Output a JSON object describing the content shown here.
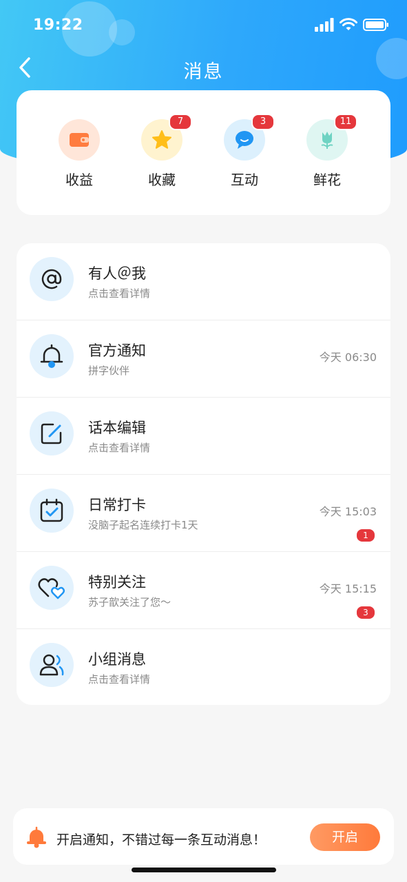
{
  "status_bar": {
    "time": "19:22"
  },
  "nav": {
    "title": "消息"
  },
  "shortcuts": [
    {
      "label": "收益",
      "icon": "wallet-icon",
      "badge": ""
    },
    {
      "label": "收藏",
      "icon": "star-icon",
      "badge": "7"
    },
    {
      "label": "互动",
      "icon": "chat-bubble-icon",
      "badge": "3"
    },
    {
      "label": "鲜花",
      "icon": "flower-icon",
      "badge": "11"
    }
  ],
  "messages": [
    {
      "title": "有人＠我",
      "subtitle": "点击查看详情",
      "time": "",
      "badge": "",
      "icon": "at-icon"
    },
    {
      "title": "官方通知",
      "subtitle": "拼字伙伴",
      "time": "今天 06:30",
      "badge": "",
      "icon": "bell-icon"
    },
    {
      "title": "话本编辑",
      "subtitle": "点击查看详情",
      "time": "",
      "badge": "",
      "icon": "edit-icon"
    },
    {
      "title": "日常打卡",
      "subtitle": "没脑子起名连续打卡1天",
      "time": "今天 15:03",
      "badge": "1",
      "icon": "calendar-check-icon"
    },
    {
      "title": "特别关注",
      "subtitle": "苏子歆关注了您～",
      "time": "今天 15:15",
      "badge": "3",
      "icon": "hearts-icon"
    },
    {
      "title": "小组消息",
      "subtitle": "点击查看详情",
      "time": "",
      "badge": "",
      "icon": "group-icon"
    }
  ],
  "notify_bar": {
    "text": "开启通知，不错过每一条互动消息！",
    "button_label": "开启"
  },
  "colors": {
    "header_blue": "#2ea8fb",
    "badge_red": "#e5373c",
    "accent_orange": "#ff7a3b",
    "icon_blue": "#2196f3"
  }
}
